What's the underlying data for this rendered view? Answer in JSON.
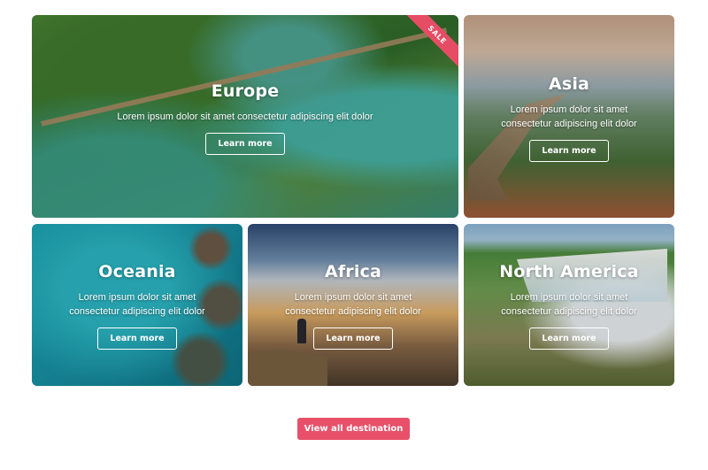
{
  "destinations": [
    {
      "title": "Europe",
      "description": "Lorem ipsum dolor sit amet consectetur adipiscing elit dolor",
      "button_label": "Learn more",
      "badge": "SALE"
    },
    {
      "title": "Asia",
      "description": "Lorem ipsum dolor sit amet consectetur adipiscing elit dolor",
      "button_label": "Learn more"
    },
    {
      "title": "Oceania",
      "description": "Lorem ipsum dolor sit amet consectetur adipiscing elit dolor",
      "button_label": "Learn more"
    },
    {
      "title": "Africa",
      "description": "Lorem ipsum dolor sit amet consectetur adipiscing elit dolor",
      "button_label": "Learn more"
    },
    {
      "title": "North America",
      "description": "Lorem ipsum dolor sit amet consectetur adipiscing elit dolor",
      "button_label": "Learn more"
    }
  ],
  "view_all_label": "View all destination",
  "colors": {
    "accent": "#e8506a",
    "ribbon": "#e74c65",
    "text_on_image": "#ffffff"
  }
}
